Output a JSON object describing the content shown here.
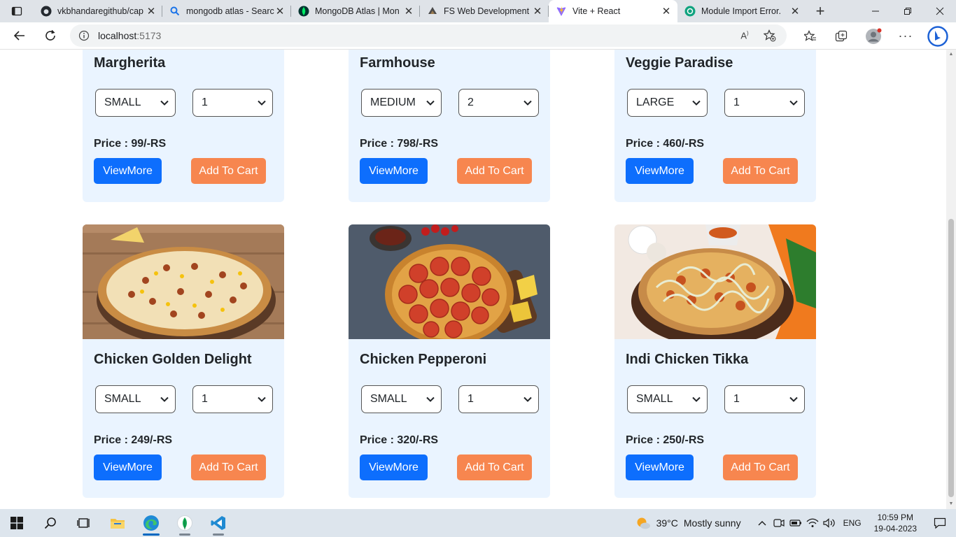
{
  "browser": {
    "tabs": [
      {
        "title": "vkbhandaregithub/cap",
        "icon": "github-icon",
        "color": "#24292f"
      },
      {
        "title": "mongodb atlas - Searc",
        "icon": "search-icon",
        "color": "#1a73e8"
      },
      {
        "title": "MongoDB Atlas | Mon",
        "icon": "mongodb-leaf-icon",
        "color": "#00684a"
      },
      {
        "title": "FS Web Development",
        "icon": "course-icon",
        "color": "#3a3a3a"
      },
      {
        "title": "Vite + React",
        "icon": "vite-icon",
        "color": "#8f6bff",
        "active": true
      },
      {
        "title": "Module Import Error.",
        "icon": "chatgpt-icon",
        "color": "#10a37f"
      }
    ],
    "address": {
      "host": "localhost",
      "port": ":5173"
    }
  },
  "colors": {
    "accent_blue": "#0d6efd",
    "cart_orange": "#f7864f",
    "card_bg": "#eaf4ff"
  },
  "cards": [
    {
      "name": "Margherita",
      "size": "SMALL",
      "qty": "1",
      "price": "Price : 99/-RS",
      "view": "ViewMore",
      "cart": "Add To Cart"
    },
    {
      "name": "Farmhouse",
      "size": "MEDIUM",
      "qty": "2",
      "price": "Price : 798/-RS",
      "view": "ViewMore",
      "cart": "Add To Cart"
    },
    {
      "name": "Veggie Paradise",
      "size": "LARGE",
      "qty": "1",
      "price": "Price : 460/-RS",
      "view": "ViewMore",
      "cart": "Add To Cart"
    },
    {
      "name": "Chicken Golden Delight",
      "size": "SMALL",
      "qty": "1",
      "price": "Price : 249/-RS",
      "view": "ViewMore",
      "cart": "Add To Cart"
    },
    {
      "name": "Chicken Pepperoni",
      "size": "SMALL",
      "qty": "1",
      "price": "Price : 320/-RS",
      "view": "ViewMore",
      "cart": "Add To Cart"
    },
    {
      "name": "Indi Chicken Tikka",
      "size": "SMALL",
      "qty": "1",
      "price": "Price : 250/-RS",
      "view": "ViewMore",
      "cart": "Add To Cart"
    }
  ],
  "taskbar": {
    "weather_temp": "39°C",
    "weather_text": "Mostly sunny",
    "lang": "ENG",
    "time": "10:59 PM",
    "date": "19-04-2023"
  }
}
